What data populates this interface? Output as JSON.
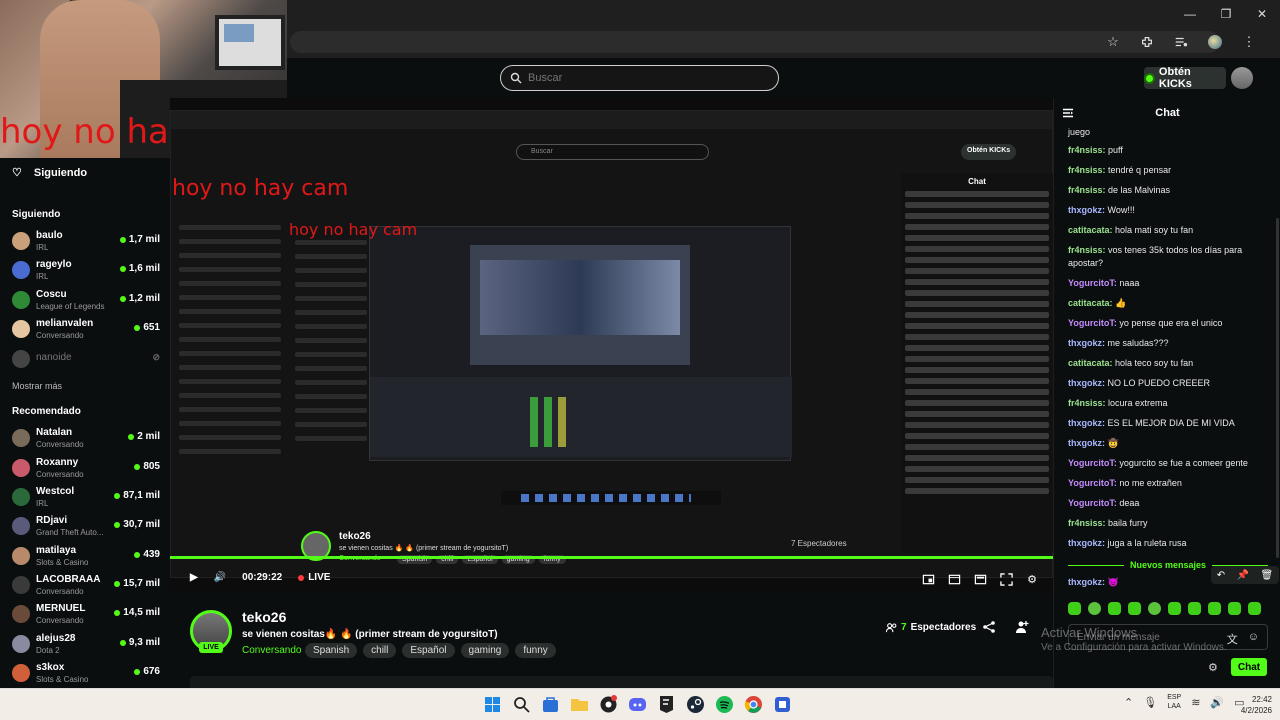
{
  "browser": {
    "window_controls": [
      "—",
      "❐",
      "✕"
    ]
  },
  "webcam": {
    "overlay_text": "hoy no hay cam"
  },
  "header": {
    "search_placeholder": "Buscar",
    "kicks_label": "Obtén KICKs"
  },
  "sidebar": {
    "following_title": "Siguiendo",
    "following_section": "Siguiendo",
    "following": [
      {
        "name": "baulo",
        "category": "IRL",
        "viewers": "1,7 mil",
        "color": "#c9a07a"
      },
      {
        "name": "rageylo",
        "category": "IRL",
        "viewers": "1,6 mil",
        "color": "#4a6bd0"
      },
      {
        "name": "Coscu",
        "category": "League of Legends",
        "viewers": "1,2 mil",
        "color": "#2f8a38"
      },
      {
        "name": "melianvalen",
        "category": "Conversando",
        "viewers": "651",
        "color": "#e4c7a0"
      }
    ],
    "offline": [
      {
        "name": "nanoide"
      }
    ],
    "show_more": "Mostrar más",
    "recommended_section": "Recomendado",
    "recommended": [
      {
        "name": "Natalan",
        "category": "Conversando",
        "viewers": "2 mil",
        "color": "#7a6a5a"
      },
      {
        "name": "Roxanny",
        "category": "Conversando",
        "viewers": "805",
        "color": "#c95a6a"
      },
      {
        "name": "Westcol",
        "category": "IRL",
        "viewers": "87,1 mil",
        "color": "#2a6a3a"
      },
      {
        "name": "RDjavi",
        "category": "Grand Theft Auto...",
        "viewers": "30,7 mil",
        "color": "#5a5a7a"
      },
      {
        "name": "matilaya",
        "category": "Slots & Casino",
        "viewers": "439",
        "color": "#b88a6a"
      },
      {
        "name": "LACOBRAAA",
        "category": "Conversando",
        "viewers": "15,7 mil",
        "color": "#3a3a3a"
      },
      {
        "name": "MERNUEL",
        "category": "Conversando",
        "viewers": "14,5 mil",
        "color": "#6a4a3a"
      },
      {
        "name": "alejus28",
        "category": "Dota 2",
        "viewers": "9,3 mil",
        "color": "#8a8aa0"
      },
      {
        "name": "s3kox",
        "category": "Slots & Casino",
        "viewers": "676",
        "color": "#d0603a"
      }
    ]
  },
  "player": {
    "time": "00:29:22",
    "live_label": "LIVE"
  },
  "inner_stream": {
    "search": "Buscar",
    "kicks": "Obtén KICKs",
    "chat": "Chat",
    "name": "teko26",
    "title": "se vienen cositas 🔥 🔥 (primer stream de yogursitoT)",
    "category": "Conversando",
    "tags": [
      "Spanish",
      "chill",
      "Español",
      "gaming",
      "funny"
    ],
    "viewers": "7 Espectadores"
  },
  "stream": {
    "name": "teko26",
    "live_badge": "LIVE",
    "title": "se vienen cositas🔥 🔥 (primer stream de yogursitoT)",
    "category": "Conversando",
    "tags": [
      "Spanish",
      "chill",
      "Español",
      "gaming",
      "funny"
    ],
    "viewer_count": "7",
    "viewer_label": "Espectadores"
  },
  "chat": {
    "title": "Chat",
    "messages": [
      {
        "user": "",
        "text": "juego",
        "color": "#e8e8e8"
      },
      {
        "user": "fr4nsiss:",
        "text": " puff",
        "color": "#9be38f"
      },
      {
        "user": "fr4nsiss:",
        "text": " tendré q pensar",
        "color": "#9be38f"
      },
      {
        "user": "fr4nsiss:",
        "text": " de las Malvinas",
        "color": "#9be38f"
      },
      {
        "user": "thxgokz:",
        "text": " Wow!!!",
        "color": "#a9b7ff"
      },
      {
        "user": "catitacata:",
        "text": " hola mati soy tu fan",
        "color": "#9be38f"
      },
      {
        "user": "fr4nsiss:",
        "text": " vos tenes 35k todos los días para apostar?",
        "color": "#9be38f"
      },
      {
        "user": "YogurcitoT:",
        "text": " naaa",
        "color": "#c58cff"
      },
      {
        "user": "catitacata:",
        "text": " 👍",
        "color": "#9be38f"
      },
      {
        "user": "YogurcitoT:",
        "text": " yo pense que era el unico",
        "color": "#c58cff"
      },
      {
        "user": "thxgokz:",
        "text": " me saludas???",
        "color": "#a9b7ff"
      },
      {
        "user": "catitacata:",
        "text": " hola teco soy tu fan",
        "color": "#9be38f"
      },
      {
        "user": "thxgokz:",
        "text": " NO LO PUEDO CREEER",
        "color": "#a9b7ff"
      },
      {
        "user": "fr4nsiss:",
        "text": " locura extrema",
        "color": "#9be38f"
      },
      {
        "user": "thxgokz:",
        "text": " ES EL MEJOR DIA DE MI VIDA",
        "color": "#a9b7ff"
      },
      {
        "user": "thxgokz:",
        "text": " 🤠",
        "color": "#a9b7ff"
      },
      {
        "user": "YogurcitoT:",
        "text": " yogurcito se fue a comeer gente",
        "color": "#c58cff"
      },
      {
        "user": "YogurcitoT:",
        "text": " no me extrañen",
        "color": "#c58cff"
      },
      {
        "user": "YogurcitoT:",
        "text": " deaa",
        "color": "#c58cff"
      },
      {
        "user": "fr4nsiss:",
        "text": " baila furry",
        "color": "#9be38f"
      },
      {
        "user": "thxgokz:",
        "text": " juga a la ruleta rusa",
        "color": "#a9b7ff"
      }
    ],
    "new_messages_label": "Nuevos mensajes",
    "last_message": {
      "user": "thxgokz:",
      "text": " 😈",
      "color": "#a9b7ff"
    },
    "input_placeholder": "Enviar un mensaje",
    "send_label": "Chat"
  },
  "watermark": {
    "title": "Activar Windows",
    "subtitle": "Ve a Configuración para activar Windows."
  },
  "taskbar": {
    "lang_line1": "ESP",
    "lang_line2": "LAA",
    "time": "22:42",
    "date": "4/2/2026"
  },
  "colors": {
    "accent": "#53fc18",
    "background": "#0b0e0f"
  }
}
